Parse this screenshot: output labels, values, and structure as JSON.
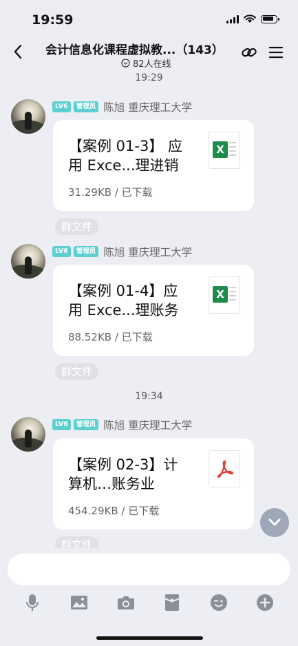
{
  "status": {
    "time": "19:59"
  },
  "header": {
    "title": "会计信息化课程虚拟教...（143）",
    "online": "82人在线"
  },
  "messages": [
    {
      "timestamp": "19:29",
      "level": "LV6",
      "role": "管理员",
      "sender": "陈旭 重庆理工大学",
      "file_name": "【案例 01-3】 应用 Exce...理进销",
      "file_size": "31.29KB / 已下载",
      "file_type": "excel",
      "tag": "群文件"
    },
    {
      "timestamp": "",
      "level": "LV6",
      "role": "管理员",
      "sender": "陈旭 重庆理工大学",
      "file_name": "【案例 01-4】应用 Exce...理账务",
      "file_size": "88.52KB / 已下载",
      "file_type": "excel",
      "tag": "群文件"
    },
    {
      "timestamp": "19:34",
      "level": "LV6",
      "role": "管理员",
      "sender": "陈旭 重庆理工大学",
      "file_name": "【案例 02-3】计算机…账务业",
      "file_size": "454.29KB / 已下载",
      "file_type": "pdf",
      "tag": "群文件"
    }
  ],
  "toolbar": [
    "microphone-icon",
    "image-icon",
    "camera-icon",
    "red-packet-icon",
    "emoji-icon",
    "plus-icon"
  ],
  "colors": {
    "badge": "#5dcfd0",
    "excel": "#1f8b4d",
    "pdf": "#e0403a",
    "scroll_button": "#9ea8b8"
  }
}
